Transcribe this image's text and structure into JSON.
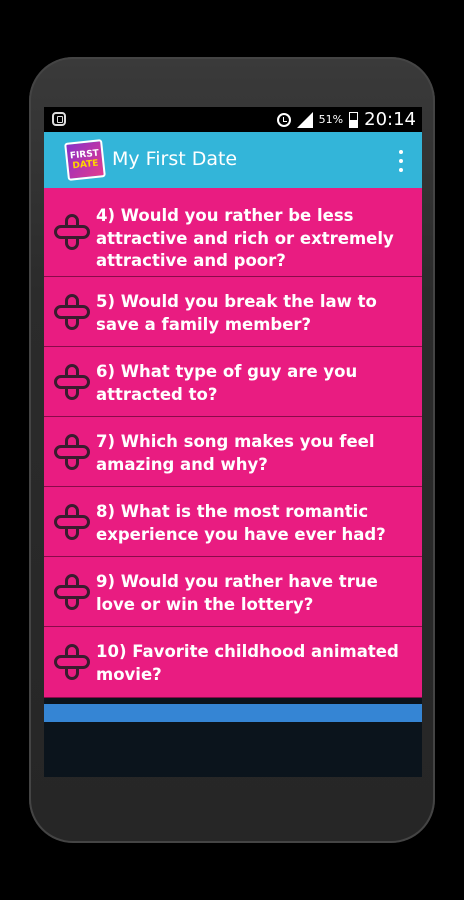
{
  "statusbar": {
    "battery_percent": "51%",
    "time": "20:14"
  },
  "appbar": {
    "title": "My First Date",
    "logo_text_top": "FIRST",
    "logo_text_bottom": "DATE"
  },
  "questions": [
    {
      "text": "4) Would you rather be less attractive and rich or extremely attractive and poor?"
    },
    {
      "text": "5) Would you break the law to save a family member?"
    },
    {
      "text": "6) What type of guy are you attracted to?"
    },
    {
      "text": "7) Which song makes you feel amazing and why?"
    },
    {
      "text": "8) What is the most romantic experience you have ever had?"
    },
    {
      "text": "9) Would you rather have true love or win the lottery?"
    },
    {
      "text": "10) Favorite childhood animated movie?"
    }
  ],
  "colors": {
    "appbar": "#33b5d9",
    "item_bg": "#e91c81",
    "bottombar": "#3585d4"
  }
}
